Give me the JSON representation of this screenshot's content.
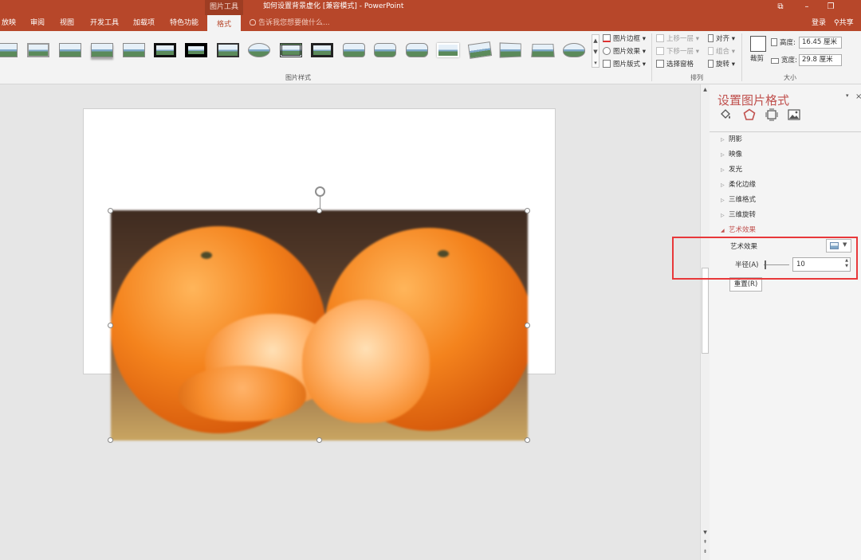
{
  "titlebar": {
    "context_tools": "图片工具",
    "doc_title": "如何设置背景虚化 [兼容模式] - PowerPoint",
    "buttons": [
      "⧉",
      "–",
      "❐"
    ]
  },
  "tabs": {
    "items": [
      "放映",
      "审阅",
      "视图",
      "开发工具",
      "加载项",
      "特色功能",
      "格式"
    ],
    "tell_me": "告诉我您想要做什么...",
    "login": "登录",
    "share": "共享"
  },
  "ribbon": {
    "gallery_label": "图片样式",
    "border_label": "图片边框",
    "effects_label": "图片效果",
    "layout_label": "图片版式",
    "bring_forward": "上移一层",
    "send_backward": "下移一层",
    "selection_pane": "选择窗格",
    "align": "对齐",
    "group": "组合",
    "rotate": "旋转",
    "arrange_label": "排列",
    "crop": "裁剪",
    "height_label": "高度:",
    "height_value": "16.45 厘米",
    "width_label": "宽度:",
    "width_value": "29.8 厘米",
    "size_label": "大小"
  },
  "pane": {
    "title": "设置图片格式",
    "sections": [
      "阴影",
      "映像",
      "发光",
      "柔化边缘",
      "三维格式",
      "三维旋转",
      "艺术效果"
    ],
    "artistic_effects_label": "艺术效果",
    "radius_label": "半径(A)",
    "radius_value": "10",
    "reset_label": "重置(R)"
  },
  "colors": {
    "accent": "#b7472a",
    "pane_title": "#c0504d",
    "highlight_box": "#e8383a"
  }
}
